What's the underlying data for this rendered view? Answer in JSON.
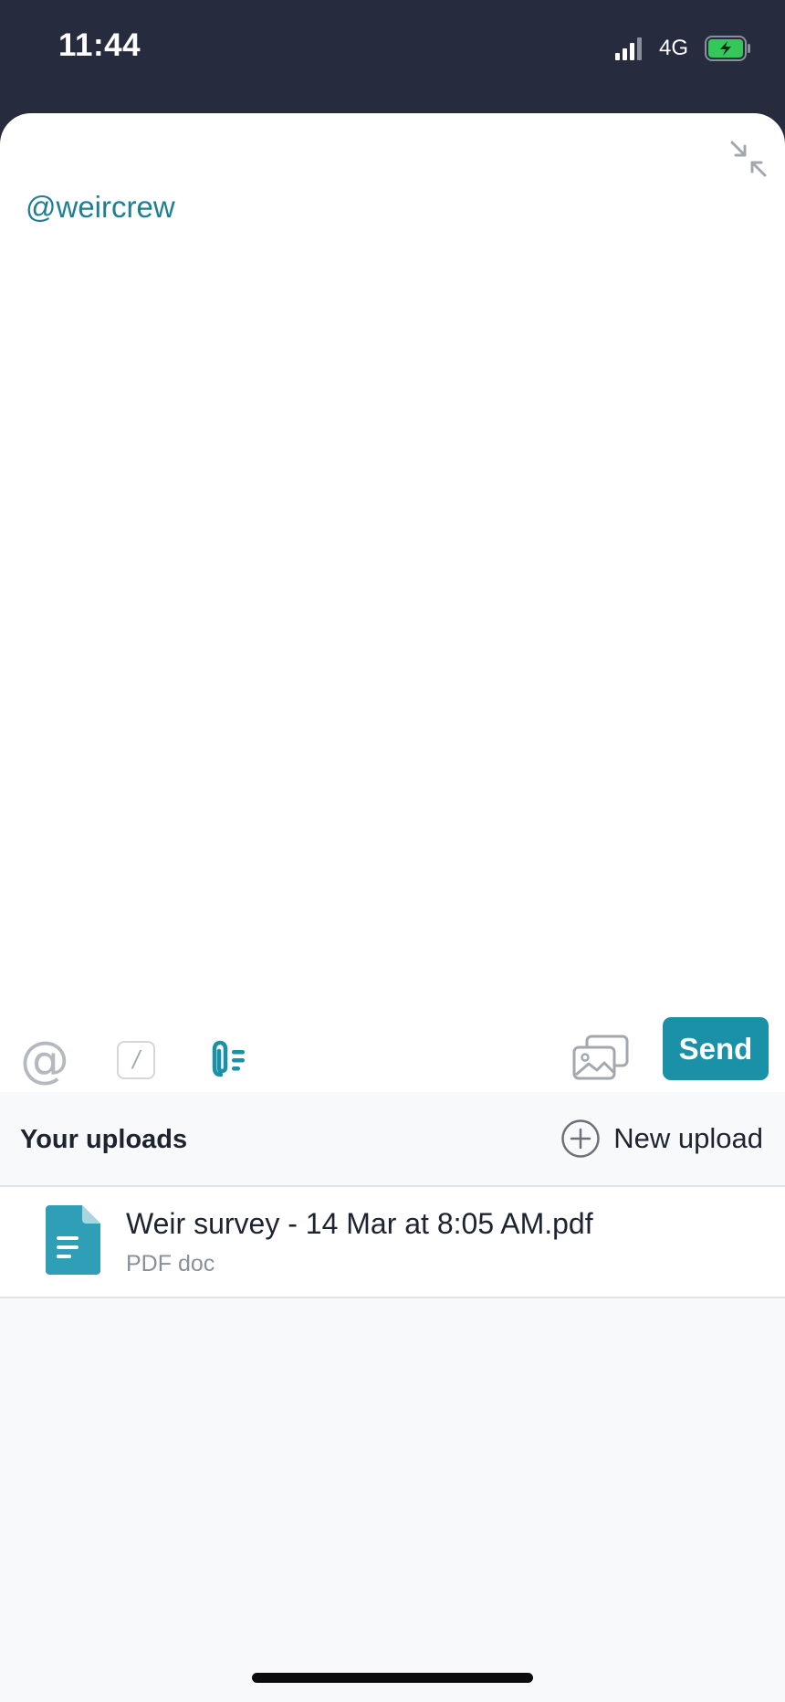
{
  "status_bar": {
    "time": "11:44",
    "network": "4G",
    "icons": [
      "signal-icon",
      "battery-charging-icon"
    ],
    "battery_color": "#34c759"
  },
  "compose": {
    "text": "@weircrew",
    "collapse_icon": "collapse-icon",
    "text_color": "#1e7f93"
  },
  "toolbar": {
    "mention_symbol": "@",
    "slash_symbol": "/",
    "attach_icon": "attachment-icon",
    "image_icon": "image-gallery-icon",
    "send_label": "Send",
    "accent_color": "#1a91a6"
  },
  "uploads": {
    "title": "Your uploads",
    "new_upload_label": "New upload",
    "new_upload_icon": "plus-circle-icon",
    "files": [
      {
        "name": "Weir survey - 14 Mar at 8:05 AM.pdf",
        "type": "PDF doc",
        "icon": "document-icon"
      }
    ]
  }
}
